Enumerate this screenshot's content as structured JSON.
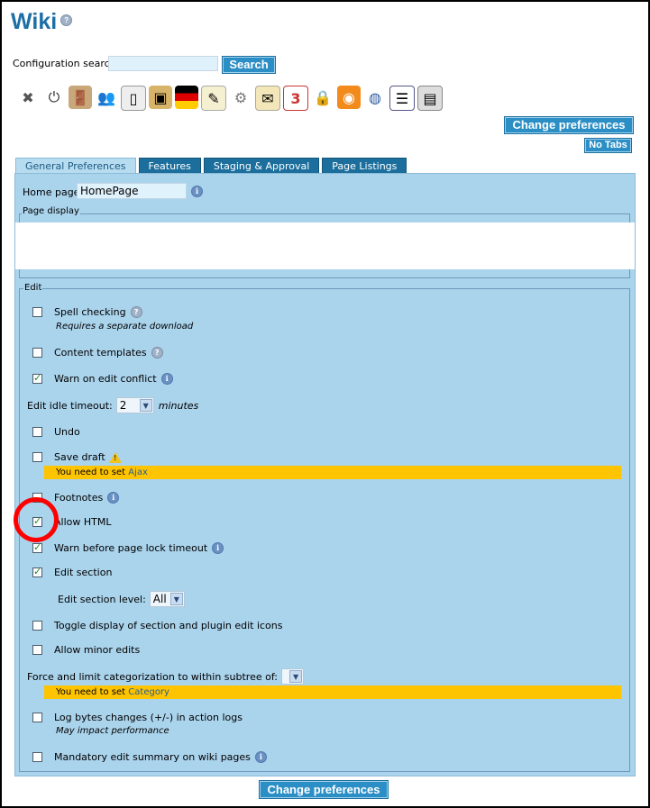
{
  "page": {
    "title": "Wiki",
    "config_search_label": "Configuration search:",
    "config_search_value": "",
    "search_button": "Search",
    "change_preferences": "Change preferences",
    "no_tabs": "No Tabs"
  },
  "toolbar_icons": [
    "tools-icon",
    "power-icon",
    "door-exit-icon",
    "users-icon",
    "page-icon",
    "image-frame-icon",
    "german-flag-icon",
    "notepad-icon",
    "puzzle-icon",
    "mail-icon",
    "calendar-icon",
    "lock-icon",
    "rss-icon",
    "globe-icon",
    "document-icon",
    "rolodex-icon"
  ],
  "tabs": [
    {
      "label": "General Preferences",
      "active": true
    },
    {
      "label": "Features",
      "active": false
    },
    {
      "label": "Staging & Approval",
      "active": false
    },
    {
      "label": "Page Listings",
      "active": false
    }
  ],
  "general": {
    "home_page_label": "Home page:",
    "home_page_value": "HomePage",
    "page_display_legend": "Page display",
    "edit_legend": "Edit"
  },
  "edit": {
    "spell_checking": {
      "label": "Spell checking",
      "checked": false,
      "note": "Requires a separate download"
    },
    "content_templates": {
      "label": "Content templates",
      "checked": false
    },
    "warn_edit_conflict": {
      "label": "Warn on edit conflict",
      "checked": true
    },
    "edit_idle_timeout": {
      "label": "Edit idle timeout:",
      "value": "2",
      "unit": "minutes"
    },
    "undo": {
      "label": "Undo",
      "checked": false
    },
    "save_draft": {
      "label": "Save draft",
      "checked": false,
      "warning_prefix": "You need to set",
      "warning_link": "Ajax"
    },
    "footnotes": {
      "label": "Footnotes",
      "checked": false
    },
    "allow_html": {
      "label": "Allow HTML",
      "checked": true
    },
    "warn_page_lock": {
      "label": "Warn before page lock timeout",
      "checked": true
    },
    "edit_section": {
      "label": "Edit section",
      "checked": true
    },
    "edit_section_level": {
      "label": "Edit section level:",
      "value": "All"
    },
    "toggle_display": {
      "label": "Toggle display of section and plugin edit icons",
      "checked": false
    },
    "allow_minor": {
      "label": "Allow minor edits",
      "checked": false
    },
    "force_categorization": {
      "label": "Force and limit categorization to within subtree of:",
      "value": "",
      "warning_prefix": "You need to set",
      "warning_link": "Category"
    },
    "log_bytes": {
      "label": "Log bytes changes (+/-) in action logs",
      "checked": false,
      "note": "May impact performance"
    },
    "mandatory_summary": {
      "label": "Mandatory edit summary on wiki pages",
      "checked": false
    }
  },
  "colors": {
    "accent": "#2b8fc6",
    "panel": "#aad3ec",
    "warning": "#ffc400",
    "highlight_circle": "#ff0000"
  }
}
